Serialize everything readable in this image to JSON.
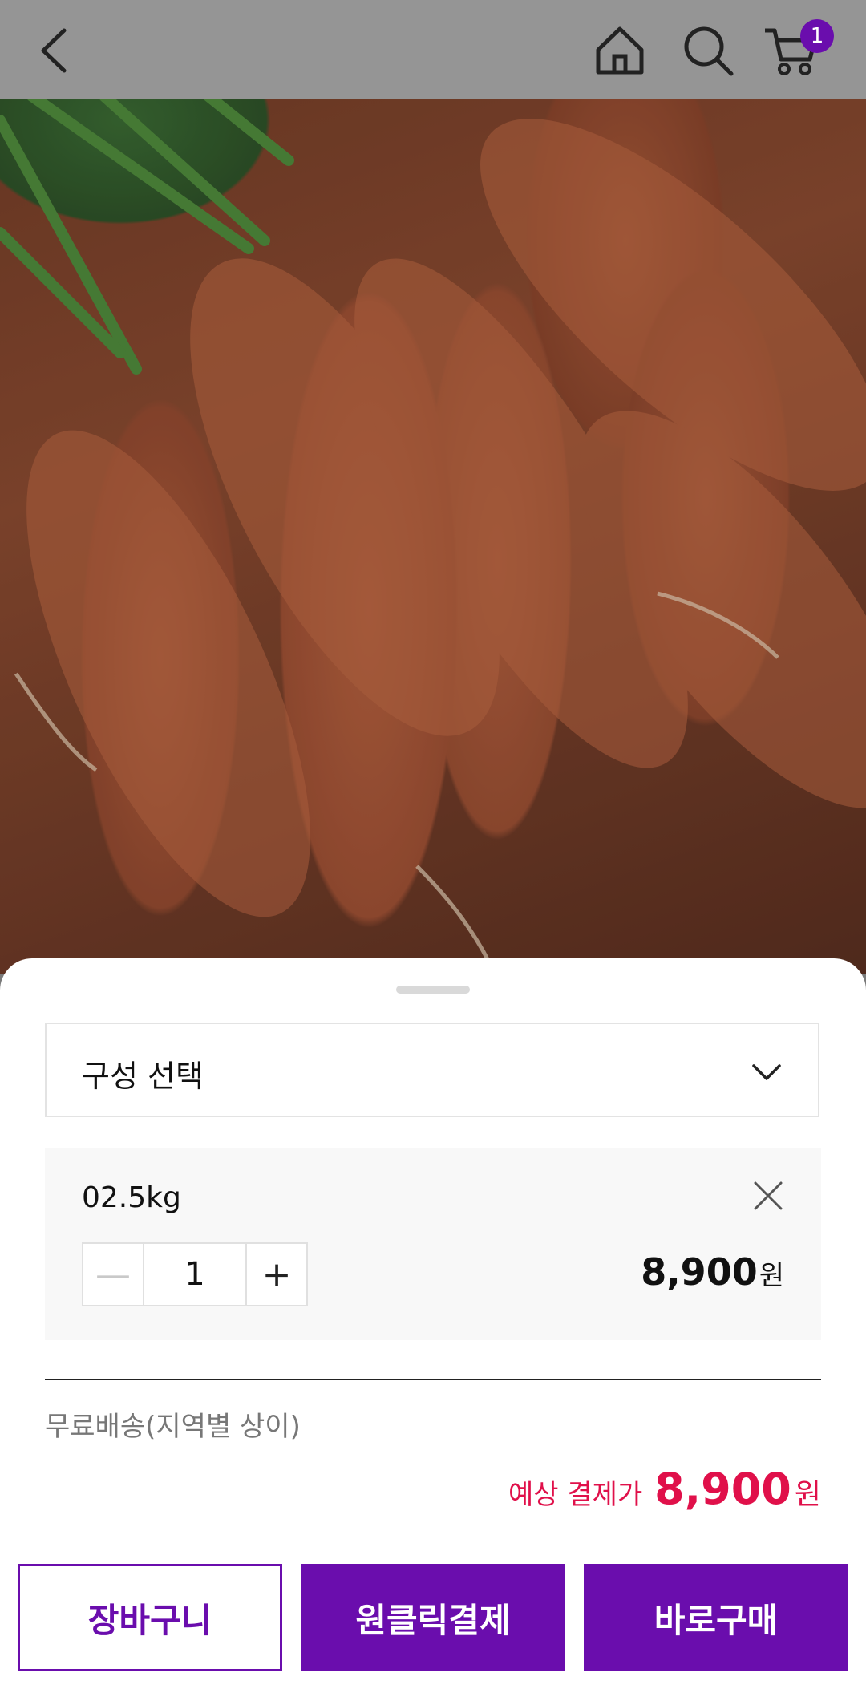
{
  "header": {
    "cart_badge": "1"
  },
  "sheet": {
    "select_placeholder": "구성 선택",
    "option": {
      "name": "02.5kg",
      "quantity": "1",
      "price": "8,900",
      "price_unit": "원",
      "minus_symbol": "—",
      "plus_symbol": "+"
    },
    "shipping_note": "무료배송(지역별 상이)",
    "total_label": "예상 결제가",
    "total_amount": "8,900",
    "total_unit": "원"
  },
  "actions": {
    "cart_label": "장바구니",
    "oneclick_label": "원클릭결제",
    "buy_label": "바로구매"
  },
  "colors": {
    "accent": "#6a0dad",
    "price_highlight": "#e0104a"
  }
}
